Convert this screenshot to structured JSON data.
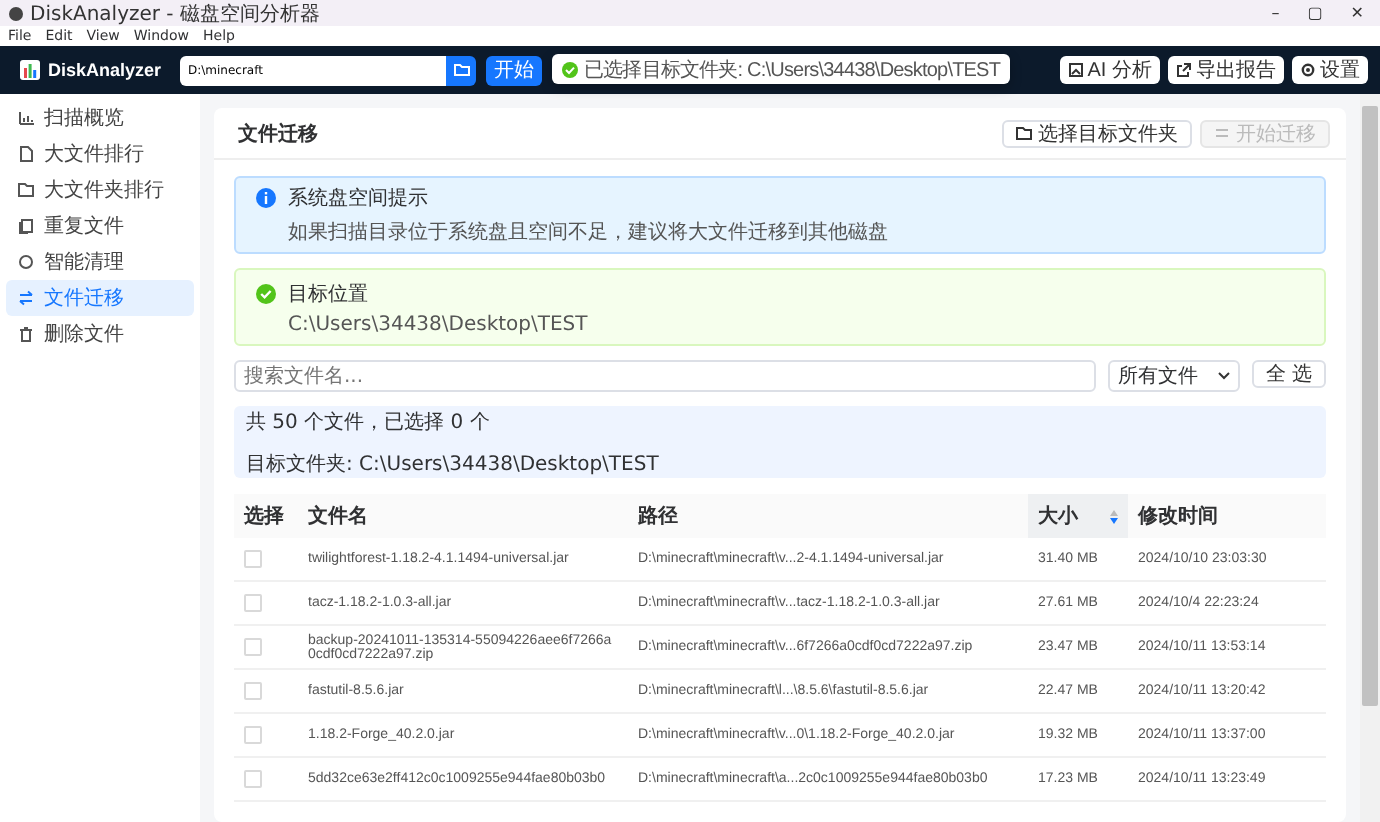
{
  "window": {
    "title": "DiskAnalyzer - 磁盘空间分析器",
    "controls": [
      "–",
      "▢",
      "✕"
    ]
  },
  "menu": [
    "File",
    "Edit",
    "View",
    "Window",
    "Help"
  ],
  "header": {
    "app_name": "DiskAnalyzer",
    "path_field": {
      "value": "D:\\minecraft"
    },
    "scan_button": "开始",
    "actions": [
      {
        "label": "AI 分析",
        "kind": "ai"
      },
      {
        "label": "导出报告",
        "kind": "export"
      },
      {
        "label": "设置",
        "kind": "settings"
      }
    ]
  },
  "toast": {
    "text": "已选择目标文件夹: C:\\Users\\34438\\Desktop\\TEST"
  },
  "sidebar": {
    "items": [
      {
        "label": "扫描概览",
        "kind": "chart",
        "selected": false
      },
      {
        "label": "大文件排行",
        "kind": "file",
        "selected": false
      },
      {
        "label": "大文件夹排行",
        "kind": "folder",
        "selected": false
      },
      {
        "label": "重复文件",
        "kind": "copy",
        "selected": false
      },
      {
        "label": "智能清理",
        "kind": "clean",
        "selected": false
      },
      {
        "label": "文件迁移",
        "kind": "migrate",
        "selected": true
      },
      {
        "label": "删除文件",
        "kind": "delete",
        "selected": false
      }
    ]
  },
  "panel": {
    "title": "文件迁移",
    "buttons": [
      {
        "label": "选择目标文件夹",
        "disabled": false
      },
      {
        "label": "开始迁移",
        "disabled": true
      }
    ],
    "alerts": [
      {
        "kind": "info",
        "title": "系统盘空间提示",
        "text": "如果扫描目录位于系统盘且空间不足，建议将大文件迁移到其他磁盘"
      },
      {
        "kind": "success",
        "title": "目标位置",
        "text": "C:\\Users\\34438\\Desktop\\TEST"
      }
    ],
    "search": {
      "placeholder": "搜索文件名..."
    },
    "filter": {
      "value": "所有文件"
    },
    "select_all": "全 选",
    "summary": [
      "共 50 个文件，已选择 0 个",
      "目标文件夹: C:\\Users\\34438\\Desktop\\TEST"
    ],
    "table": {
      "columns": [
        {
          "label": "选择",
          "sorted": false
        },
        {
          "label": "文件名",
          "sorted": false
        },
        {
          "label": "路径",
          "sorted": false
        },
        {
          "label": "大小",
          "sorted": true
        },
        {
          "label": "修改时间",
          "sorted": false
        }
      ],
      "rows": [
        {
          "checked": false,
          "name": "twilightforest-1.18.2-4.1.1494-universal.jar",
          "path": "D:\\minecraft\\minecraft\\v...2-4.1.1494-universal.jar",
          "size": "31.40 MB",
          "modified": "2024/10/10 23:03:30"
        },
        {
          "checked": false,
          "name": "tacz-1.18.2-1.0.3-all.jar",
          "path": "D:\\minecraft\\minecraft\\v...tacz-1.18.2-1.0.3-all.jar",
          "size": "27.61 MB",
          "modified": "2024/10/4 22:23:24"
        },
        {
          "checked": false,
          "name": "backup-20241011-135314-55094226aee6f7266a0cdf0cd7222a97.zip",
          "path": "D:\\minecraft\\minecraft\\v...6f7266a0cdf0cd7222a97.zip",
          "size": "23.47 MB",
          "modified": "2024/10/11 13:53:14"
        },
        {
          "checked": false,
          "name": "fastutil-8.5.6.jar",
          "path": "D:\\minecraft\\minecraft\\l...\\8.5.6\\fastutil-8.5.6.jar",
          "size": "22.47 MB",
          "modified": "2024/10/11 13:20:42"
        },
        {
          "checked": false,
          "name": "1.18.2-Forge_40.2.0.jar",
          "path": "D:\\minecraft\\minecraft\\v...0\\1.18.2-Forge_40.2.0.jar",
          "size": "19.32 MB",
          "modified": "2024/10/11 13:37:00"
        },
        {
          "checked": false,
          "name": "5dd32ce63e2ff412c0c1009255e944fae80b03b0",
          "path": "D:\\minecraft\\minecraft\\a...2c0c1009255e944fae80b03b0",
          "size": "17.23 MB",
          "modified": "2024/10/11 13:23:49"
        }
      ]
    }
  }
}
